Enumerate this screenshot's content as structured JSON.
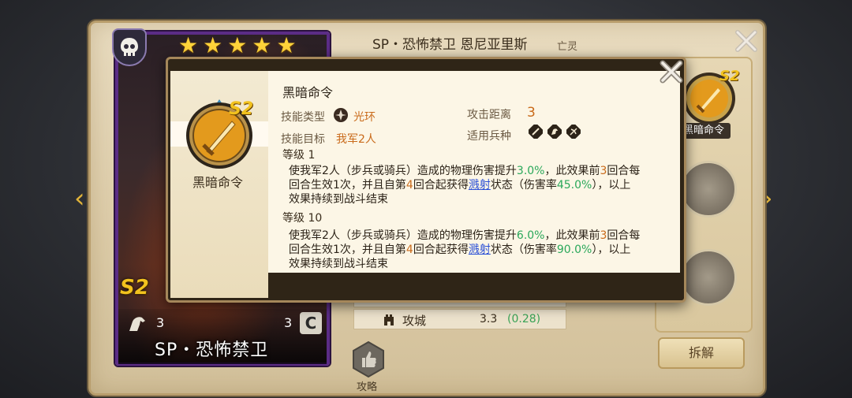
{
  "hero": {
    "title": "SP・恐怖禁卫 恩尼亚里斯",
    "race": "亡灵",
    "card_name": "SP・恐怖禁卫",
    "skill_tier": "S2",
    "stars": 5,
    "stat_left": "3",
    "stat_right": "3",
    "rank_badge": "C"
  },
  "stats": {
    "siege_label": "攻城",
    "siege_value": "3.3",
    "siege_growth": "(0.28)"
  },
  "buttons": {
    "strategy_label": "攻略",
    "disband_label": "拆解"
  },
  "right_panel": {
    "skill_label": "黑暗命令",
    "skill_tier": "S2"
  },
  "popup": {
    "skill_name": "黑暗命令",
    "skill_tier": "S2",
    "title": "黑暗命令",
    "type_label": "技能类型",
    "type_value": "光环",
    "target_label": "技能目标",
    "target_value": "我军2人",
    "range_label": "攻击距离",
    "range_value": "3",
    "troops_label": "适用兵种",
    "level1_title": "等级 1",
    "level1": {
      "line1_a": "使我军2人（步兵或骑兵）造成的物理伤害提升",
      "line1_pct": "3.0%",
      "line1_b": "，此效果前",
      "line1_n": "3",
      "line1_c": "回合每",
      "line2_a": "回合生效1次，并且自第",
      "line2_n": "4",
      "line2_b": "回合起获得",
      "line2_link": "溅射",
      "line2_c": "状态（伤害率",
      "line2_pct": "45.0%",
      "line2_d": "），以上",
      "line3": "效果持续到战斗结束"
    },
    "level10_title": "等级 10",
    "level10": {
      "line1_a": "使我军2人（步兵或骑兵）造成的物理伤害提升",
      "line1_pct": "6.0%",
      "line1_b": "，此效果前",
      "line1_n": "3",
      "line1_c": "回合每",
      "line2_a": "回合生效1次，并且自第",
      "line2_n": "4",
      "line2_b": "回合起获得",
      "line2_link": "溅射",
      "line2_c": "状态（伤害率",
      "line2_pct": "90.0%",
      "line2_d": "），以上",
      "line3": "效果持续到战斗结束"
    }
  },
  "colors": {
    "accent_gold": "#f2c21e",
    "card_border": "#5b2c86",
    "highlight_green": "#2aa85a",
    "highlight_orange": "#c96a1a",
    "link_blue": "#2a4fd6"
  }
}
